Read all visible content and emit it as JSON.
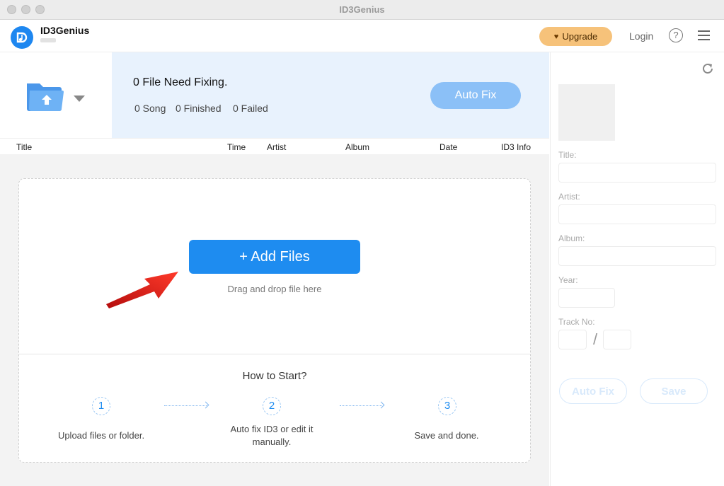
{
  "window": {
    "title": "ID3Genius"
  },
  "app": {
    "name": "ID3Genius"
  },
  "header": {
    "upgrade_label": "Upgrade",
    "login_label": "Login",
    "help_glyph": "?"
  },
  "status": {
    "headline": "0 File Need Fixing.",
    "songs": "0 Song",
    "finished": "0 Finished",
    "failed": "0 Failed",
    "auto_fix_label": "Auto Fix"
  },
  "table": {
    "columns": [
      "Title",
      "Time",
      "Artist",
      "Album",
      "Date",
      "ID3 Info"
    ]
  },
  "dropzone": {
    "add_files_label": "+ Add Files",
    "drag_text": "Drag and drop file here",
    "how_to_start": "How to Start?",
    "steps": [
      {
        "number": "1",
        "text": "Upload files or folder."
      },
      {
        "number": "2",
        "text": "Auto fix ID3 or edit it manually."
      },
      {
        "number": "3",
        "text": "Save and done."
      }
    ]
  },
  "editor": {
    "fields": {
      "title": "Title:",
      "artist": "Artist:",
      "album": "Album:",
      "year": "Year:",
      "track_no": "Track No:"
    },
    "track_separator": "/",
    "auto_fix_label": "Auto Fix",
    "save_label": "Save"
  },
  "colors": {
    "accent": "#1e8cf0",
    "upgrade_bg": "#f6c27a",
    "status_bg": "#e8f2fd",
    "arrow": "#e41b1b"
  },
  "icons": {
    "logo": "music-note-logo-icon",
    "folder": "upload-folder-icon",
    "refresh": "refresh-icon",
    "menu": "hamburger-menu-icon",
    "help": "help-circle-icon",
    "heart": "diamond-heart-icon"
  }
}
